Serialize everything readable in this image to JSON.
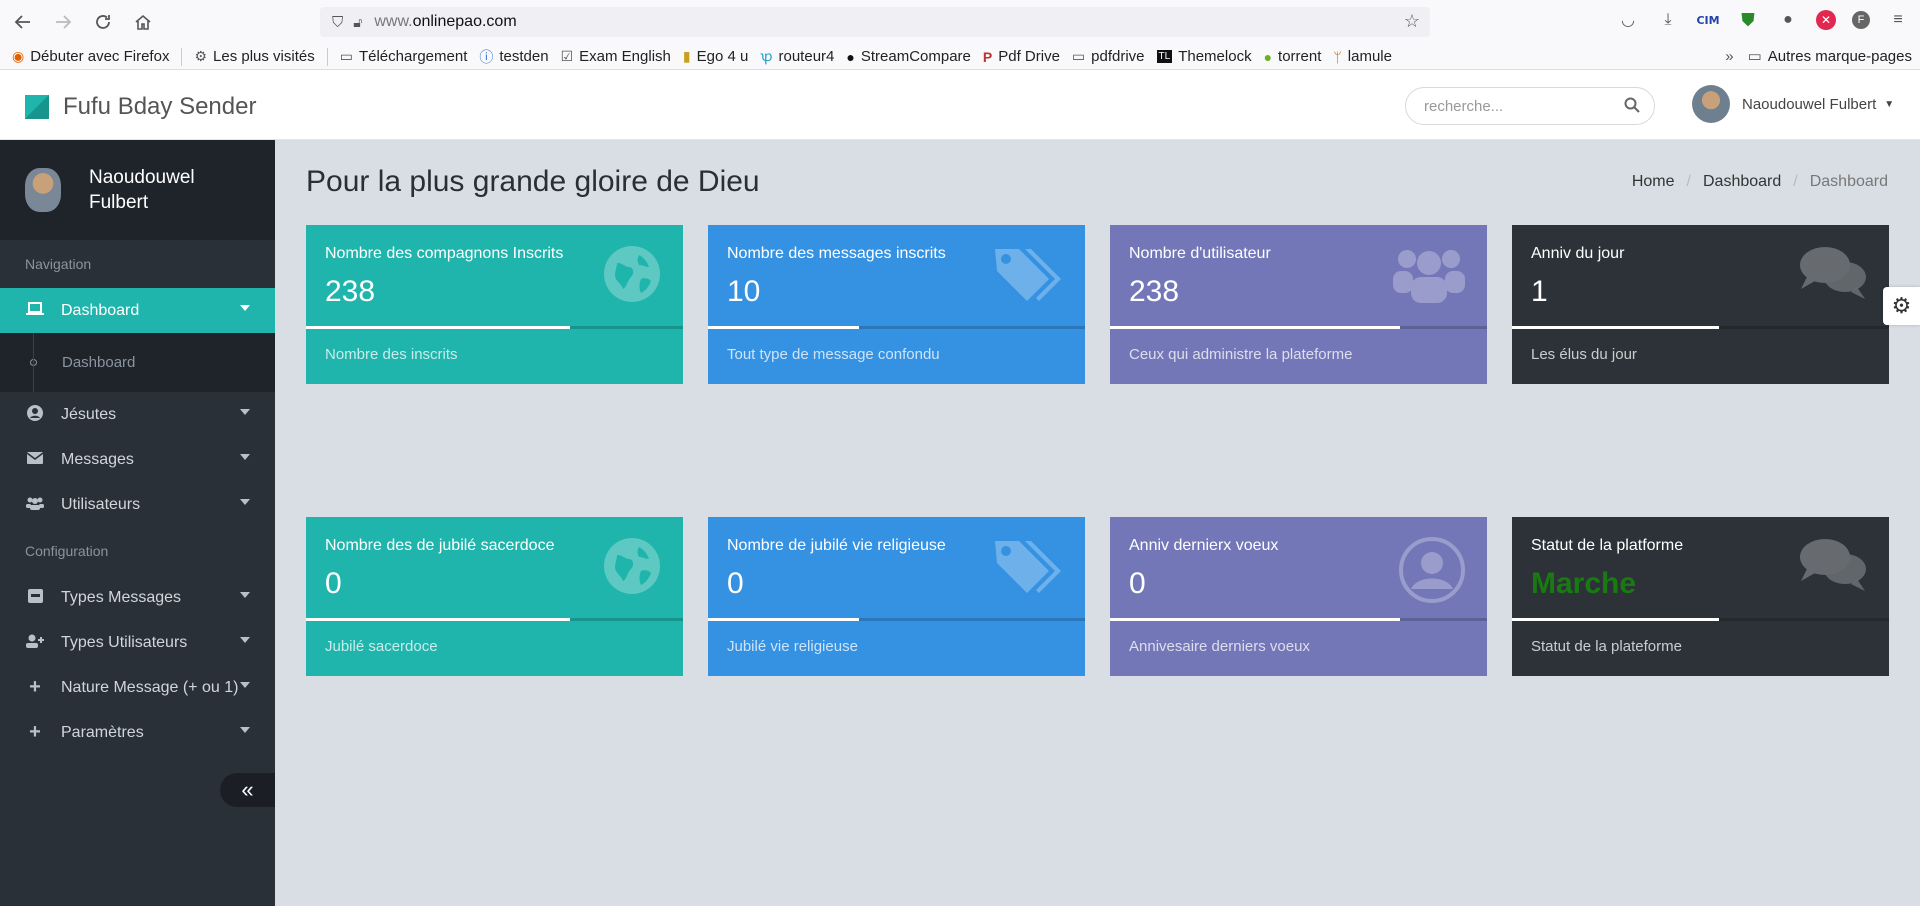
{
  "browser": {
    "url_domain": "onlinepao.com",
    "url_prefix": "www.",
    "bookmarks": [
      {
        "label": "Débuter avec Firefox",
        "icon": "firefox-icon"
      },
      {
        "label": "Les plus visités",
        "icon": "gear-icon"
      },
      {
        "label": "Téléchargement",
        "icon": "folder-icon"
      },
      {
        "label": "testden",
        "icon": "info-icon"
      },
      {
        "label": "Exam English",
        "icon": "check-icon"
      },
      {
        "label": "Ego 4 u",
        "icon": "ego-icon"
      },
      {
        "label": "routeur4",
        "icon": "tplink-icon"
      },
      {
        "label": "StreamCompare",
        "icon": "github-icon"
      },
      {
        "label": "Pdf Drive",
        "icon": "pdf-icon"
      },
      {
        "label": "pdfdrive",
        "icon": "folder-icon"
      },
      {
        "label": "Themelock",
        "icon": "tl-icon"
      },
      {
        "label": "torrent",
        "icon": "torrent-icon"
      },
      {
        "label": "lamule",
        "icon": "mule-icon"
      }
    ],
    "other_bookmarks": "Autres marque-pages",
    "cim_label": "CIM",
    "profile_letter": "F"
  },
  "app": {
    "brand": "Fufu Bday Sender",
    "search_placeholder": "recherche...",
    "user_name": "Naoudouwel Fulbert"
  },
  "sidebar": {
    "profile_name": "Naoudouwel Fulbert",
    "section_navigation": "Navigation",
    "section_configuration": "Configuration",
    "items": [
      {
        "label": "Dashboard",
        "icon": "laptop-icon",
        "active": true
      },
      {
        "label": "Jésutes",
        "icon": "user-circle-icon"
      },
      {
        "label": "Messages",
        "icon": "envelope-icon"
      },
      {
        "label": "Utilisateurs",
        "icon": "users-icon"
      },
      {
        "label": "Types Messages",
        "icon": "inbox-icon"
      },
      {
        "label": "Types Utilisateurs",
        "icon": "user-plus-icon"
      },
      {
        "label": "Nature Message (+ ou 1)",
        "icon": "plus-icon"
      },
      {
        "label": "Paramètres",
        "icon": "plus-icon"
      }
    ],
    "sub_items": [
      {
        "label": "Dashboard"
      }
    ]
  },
  "main": {
    "title": "Pour la plus grande gloire de Dieu",
    "breadcrumb": [
      "Home",
      "Dashboard",
      "Dashboard"
    ],
    "cards": [
      {
        "title": "Nombre des compagnons Inscrits",
        "value": "238",
        "footer": "Nombre des inscrits",
        "icon": "globe-icon",
        "color": "#1fb5ac",
        "progress": 0.7
      },
      {
        "title": "Nombre des messages inscrits",
        "value": "10",
        "footer": "Tout type de message confondu",
        "icon": "tags-icon",
        "color": "#3592e3",
        "progress": 0.4
      },
      {
        "title": "Nombre d'utilisateur",
        "value": "238",
        "footer": "Ceux qui administre la plateforme",
        "icon": "users-icon",
        "color": "#7377b8",
        "progress": 0.77
      },
      {
        "title": "Anniv du jour",
        "value": "1",
        "footer": "Les élus du jour",
        "icon": "comments-icon",
        "color": "#2c3238",
        "progress": 0.55
      },
      {
        "title": "Nombre des de jubilé sacerdoce",
        "value": "0",
        "footer": "Jubilé sacerdoce",
        "icon": "globe-icon",
        "color": "#1fb5ac",
        "progress": 0.7
      },
      {
        "title": "Nombre de jubilé vie religieuse",
        "value": "0",
        "footer": "Jubilé vie religieuse",
        "icon": "tags-icon",
        "color": "#3592e3",
        "progress": 0.4
      },
      {
        "title": "Anniv dernierx voeux",
        "value": "0",
        "footer": "Annivesaire derniers voeux",
        "icon": "user-circle-icon",
        "color": "#7377b8",
        "progress": 0.77
      },
      {
        "title": "Statut de la platforme",
        "value": "Marche",
        "footer": "Statut de la plateforme",
        "icon": "comments-icon",
        "color": "#2c3238",
        "progress": 0.55,
        "value_color": "#1a7a12"
      }
    ]
  }
}
